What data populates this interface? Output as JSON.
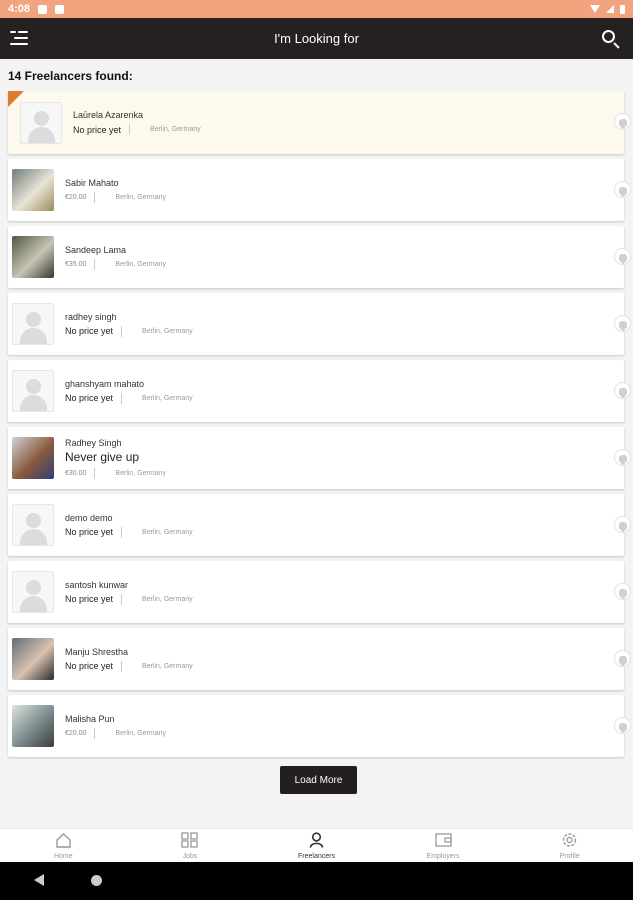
{
  "status_bar": {
    "time": "4:08"
  },
  "header": {
    "title": "I'm Looking for"
  },
  "results": {
    "count_text": "14 Freelancers found:"
  },
  "freelancers": [
    {
      "name": "Laūrela  Azarenka",
      "price": "No price yet",
      "location": "Berlin, Germany",
      "featured": true,
      "photo": false
    },
    {
      "name": "Sabir Mahato",
      "price": "€20.00",
      "location": "Berlin, Germany",
      "photo": true,
      "photo_colors": [
        "#6f7d7a",
        "#e9e4d6",
        "#9b8a58"
      ]
    },
    {
      "name": "Sandeep Lama",
      "price": "€35.00",
      "location": "Berlin, Germany",
      "photo": true,
      "photo_colors": [
        "#4d5a3c",
        "#c9c4b6",
        "#2f3a26"
      ]
    },
    {
      "name": "radhey singh",
      "price": "No price yet",
      "location": "Berlin, Germany",
      "photo": false
    },
    {
      "name": "ghanshyam mahato",
      "price": "No price yet",
      "location": "Berlin, Germany",
      "photo": false
    },
    {
      "name": "Radhey Singh",
      "tagline": "Never give up",
      "price": "€30.00",
      "location": "Berlin, Germany",
      "photo": true,
      "photo_colors": [
        "#cfd2d8",
        "#8a5a3c",
        "#2d3f7a"
      ]
    },
    {
      "name": "demo demo",
      "price": "No price yet",
      "location": "Berlin, Germany",
      "photo": false
    },
    {
      "name": "santosh kunwar",
      "price": "No price yet",
      "location": "Berlin, Germany",
      "photo": false
    },
    {
      "name": "Manju Shrestha",
      "price": "No price yet",
      "location": "Berlin, Germany",
      "photo": true,
      "photo_colors": [
        "#5f6e76",
        "#d8c2b2",
        "#2a2a2a"
      ]
    },
    {
      "name": "Malisha Pun",
      "price": "€20.00",
      "location": "Berlin, Germany",
      "photo": true,
      "photo_colors": [
        "#dfe1dd",
        "#7a8a8c",
        "#3b3b3b"
      ]
    }
  ],
  "load_more_label": "Load More",
  "bottom_nav": {
    "items": [
      {
        "label": "Home",
        "icon": "home-icon",
        "active": false
      },
      {
        "label": "Jobs",
        "icon": "grid-icon",
        "active": false
      },
      {
        "label": "Freelancers",
        "icon": "person-icon",
        "active": true
      },
      {
        "label": "Employers",
        "icon": "wallet-icon",
        "active": false
      },
      {
        "label": "Profile",
        "icon": "gear-icon",
        "active": false
      }
    ]
  },
  "colors": {
    "accent": "#e07b2c",
    "app_bar": "#252120",
    "status_bar": "#f2a47e",
    "featured_bg": "#fdfaed"
  }
}
